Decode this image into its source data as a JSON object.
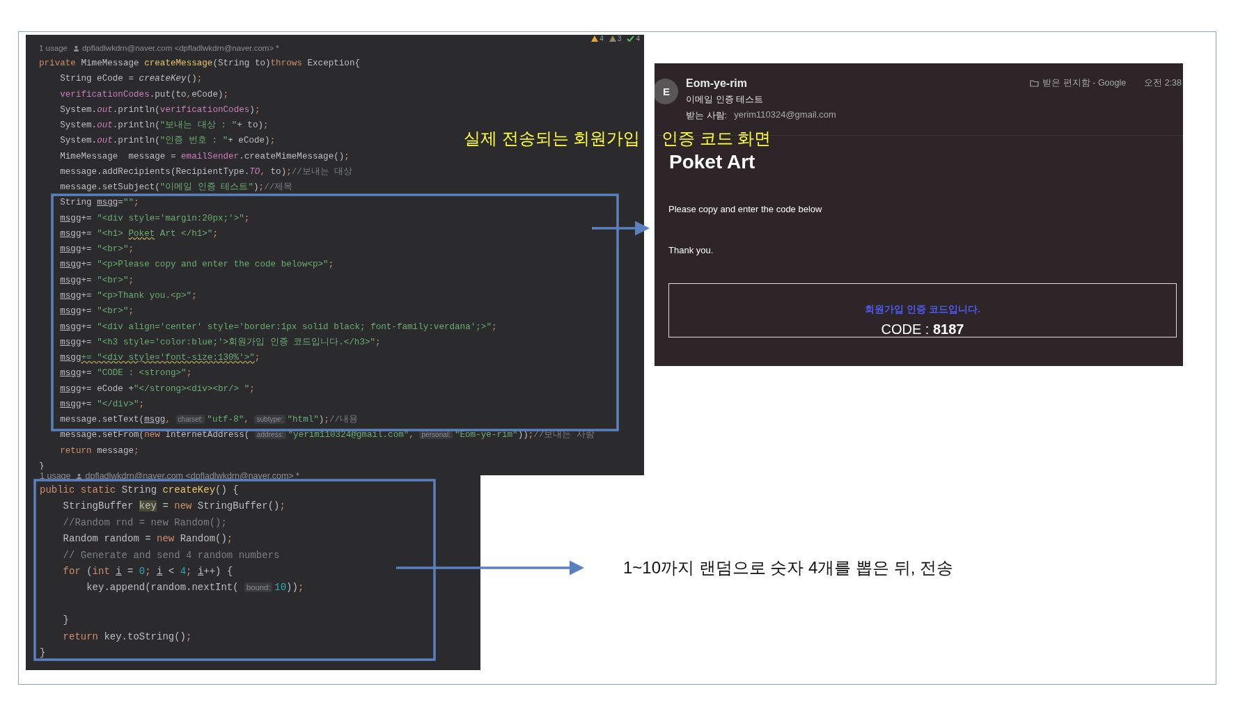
{
  "captions": [
    {
      "text": "실제 전송되는 회원가입"
    },
    {
      "text": "인증 코드 화면"
    }
  ],
  "code_panel_top": {
    "inspections": [
      {
        "kind": "warning",
        "count": "4"
      },
      {
        "kind": "weak_warning",
        "count": "3"
      },
      {
        "kind": "ok",
        "count": "4"
      }
    ],
    "usage": {
      "count": "1 usage",
      "author": "dpfladlwkdrn@naver.com <dpfladlwkdrn@naver.com> *"
    },
    "lines": [
      {
        "segments": [
          {
            "kind": "kw",
            "text": "private "
          },
          {
            "kind": "plain",
            "text": "MimeMessage "
          },
          {
            "kind": "fn",
            "text": "createMessage"
          },
          {
            "kind": "plain",
            "text": "(String to)"
          },
          {
            "kind": "kw",
            "text": "throws "
          },
          {
            "kind": "plain",
            "text": "Exception{"
          }
        ],
        "children": [
          {
            "segments": [
              {
                "kind": "plain",
                "text": "String eCode = "
              },
              {
                "kind": "italic",
                "text": "createKey"
              },
              {
                "kind": "plain",
                "text": "()"
              },
              {
                "kind": "punct",
                "text": ";"
              }
            ]
          },
          {
            "segments": [
              {
                "kind": "field",
                "text": "verificationCodes"
              },
              {
                "kind": "plain",
                "text": ".put(to"
              },
              {
                "kind": "punct",
                "text": ","
              },
              {
                "kind": "plain",
                "text": "eCode)"
              },
              {
                "kind": "punct",
                "text": ";"
              }
            ]
          },
          {
            "segments": [
              {
                "kind": "plain",
                "text": "System."
              },
              {
                "kind": "static",
                "text": "out"
              },
              {
                "kind": "plain",
                "text": ".println("
              },
              {
                "kind": "field",
                "text": "verificationCodes"
              },
              {
                "kind": "plain",
                "text": ")"
              },
              {
                "kind": "punct",
                "text": ";"
              }
            ]
          },
          {
            "segments": [
              {
                "kind": "plain",
                "text": "System."
              },
              {
                "kind": "static",
                "text": "out"
              },
              {
                "kind": "plain",
                "text": ".println("
              },
              {
                "kind": "str",
                "text": "\"보내는 대상 : \""
              },
              {
                "kind": "plain",
                "text": "+ to)"
              },
              {
                "kind": "punct",
                "text": ";"
              }
            ]
          },
          {
            "segments": [
              {
                "kind": "plain",
                "text": "System."
              },
              {
                "kind": "static",
                "text": "out"
              },
              {
                "kind": "plain",
                "text": ".println("
              },
              {
                "kind": "str",
                "text": "\"인증 번호 : \""
              },
              {
                "kind": "plain",
                "text": "+ eCode)"
              },
              {
                "kind": "punct",
                "text": ";"
              }
            ]
          },
          {
            "segments": [
              {
                "kind": "plain",
                "text": "MimeMessage  message = "
              },
              {
                "kind": "field",
                "text": "emailSender"
              },
              {
                "kind": "plain",
                "text": ".createMimeMessage()"
              },
              {
                "kind": "punct",
                "text": ";"
              }
            ]
          },
          {
            "segments": [
              {
                "kind": "plain",
                "text": "message.addRecipients(RecipientType."
              },
              {
                "kind": "static",
                "text": "TO"
              },
              {
                "kind": "punct",
                "text": ", "
              },
              {
                "kind": "plain",
                "text": "to)"
              },
              {
                "kind": "punct",
                "text": ";"
              },
              {
                "kind": "comment",
                "text": "//보내는 대상"
              }
            ]
          },
          {
            "segments": [
              {
                "kind": "plain",
                "text": "message.setSubject("
              },
              {
                "kind": "str",
                "text": "\"이메일 인증 테스트\""
              },
              {
                "kind": "plain",
                "text": ")"
              },
              {
                "kind": "punct",
                "text": ";"
              },
              {
                "kind": "comment",
                "text": "//제목"
              }
            ]
          },
          {
            "segments": [
              {
                "kind": "plain",
                "text": "String "
              },
              {
                "kind": "var",
                "text": "msgg"
              },
              {
                "kind": "plain",
                "text": "="
              },
              {
                "kind": "str",
                "text": "\"\""
              },
              {
                "kind": "punct",
                "text": ";"
              }
            ]
          },
          {
            "segments": [
              {
                "kind": "var",
                "text": "msgg"
              },
              {
                "kind": "plain",
                "text": "+= "
              },
              {
                "kind": "str",
                "text": "\"<div style='margin:20px;'>\""
              },
              {
                "kind": "punct",
                "text": ";"
              }
            ]
          },
          {
            "segments": [
              {
                "kind": "var",
                "text": "msgg"
              },
              {
                "kind": "plain",
                "text": "+= "
              },
              {
                "kind": "str",
                "text": "\"<h1> "
              },
              {
                "kind": "strwarn",
                "text": "Poket"
              },
              {
                "kind": "str",
                "text": " Art </h1>\""
              },
              {
                "kind": "punct",
                "text": ";"
              }
            ]
          },
          {
            "segments": [
              {
                "kind": "var",
                "text": "msgg"
              },
              {
                "kind": "plain",
                "text": "+= "
              },
              {
                "kind": "str",
                "text": "\"<br>\""
              },
              {
                "kind": "punct",
                "text": ";"
              }
            ]
          },
          {
            "segments": [
              {
                "kind": "var",
                "text": "msgg"
              },
              {
                "kind": "plain",
                "text": "+= "
              },
              {
                "kind": "str",
                "text": "\"<p>Please copy and enter the code below<p>\""
              },
              {
                "kind": "punct",
                "text": ";"
              }
            ]
          },
          {
            "segments": [
              {
                "kind": "var",
                "text": "msgg"
              },
              {
                "kind": "plain",
                "text": "+= "
              },
              {
                "kind": "str",
                "text": "\"<br>\""
              },
              {
                "kind": "punct",
                "text": ";"
              }
            ]
          },
          {
            "segments": [
              {
                "kind": "var",
                "text": "msgg"
              },
              {
                "kind": "plain",
                "text": "+= "
              },
              {
                "kind": "str",
                "text": "\"<p>Thank you.<p>\""
              },
              {
                "kind": "punct",
                "text": ";"
              }
            ]
          },
          {
            "segments": [
              {
                "kind": "var",
                "text": "msgg"
              },
              {
                "kind": "plain",
                "text": "+= "
              },
              {
                "kind": "str",
                "text": "\"<br>\""
              },
              {
                "kind": "punct",
                "text": ";"
              }
            ]
          },
          {
            "segments": [
              {
                "kind": "var",
                "text": "msgg"
              },
              {
                "kind": "plain",
                "text": "+= "
              },
              {
                "kind": "str",
                "text": "\"<div align='center' style='border:1px solid black; font-family:verdana';>\""
              },
              {
                "kind": "punct",
                "text": ";"
              }
            ]
          },
          {
            "segments": [
              {
                "kind": "var",
                "text": "msgg"
              },
              {
                "kind": "plain",
                "text": "+= "
              },
              {
                "kind": "str",
                "text": "\"<h3 style='color:blue;'>회원가입 인증 코드입니다.</h3>\""
              },
              {
                "kind": "punct",
                "text": ";"
              }
            ]
          },
          {
            "segments": [
              {
                "kind": "var",
                "text": "msgg"
              },
              {
                "kind": "strwarn",
                "text": "+= \"<div style='font-size:130%'>\""
              },
              {
                "kind": "punct",
                "text": ";"
              }
            ]
          },
          {
            "segments": [
              {
                "kind": "var",
                "text": "msgg"
              },
              {
                "kind": "plain",
                "text": "+= "
              },
              {
                "kind": "str",
                "text": "\"CODE : <strong>\""
              },
              {
                "kind": "punct",
                "text": ";"
              }
            ]
          },
          {
            "segments": [
              {
                "kind": "var",
                "text": "msgg"
              },
              {
                "kind": "plain",
                "text": "+= eCode +"
              },
              {
                "kind": "str",
                "text": "\"</strong><div><br/> \""
              },
              {
                "kind": "punct",
                "text": ";"
              }
            ]
          },
          {
            "segments": [
              {
                "kind": "var",
                "text": "msgg"
              },
              {
                "kind": "plain",
                "text": "+= "
              },
              {
                "kind": "str",
                "text": "\"</div>\""
              },
              {
                "kind": "punct",
                "text": ";"
              }
            ]
          },
          {
            "segments": [
              {
                "kind": "plain",
                "text": "message.setText("
              },
              {
                "kind": "var",
                "text": "msgg"
              },
              {
                "kind": "punct",
                "text": ", "
              },
              {
                "kind": "hint",
                "text": "charset:"
              },
              {
                "kind": "str",
                "text": "\"utf-8\""
              },
              {
                "kind": "punct",
                "text": ", "
              },
              {
                "kind": "hint",
                "text": "subtype:"
              },
              {
                "kind": "str",
                "text": "\"html\""
              },
              {
                "kind": "plain",
                "text": ")"
              },
              {
                "kind": "punct",
                "text": ";"
              },
              {
                "kind": "comment",
                "text": "//내용"
              }
            ]
          },
          {
            "segments": [
              {
                "kind": "plain",
                "text": "message.setFrom("
              },
              {
                "kind": "kw",
                "text": "new "
              },
              {
                "kind": "plain",
                "text": "InternetAddress( "
              },
              {
                "kind": "hint",
                "text": "address:"
              },
              {
                "kind": "str",
                "text": "\"yerim110324@gmail.com\""
              },
              {
                "kind": "punct",
                "text": ", "
              },
              {
                "kind": "hint",
                "text": "personal:"
              },
              {
                "kind": "str",
                "text": "\"Eom-ye-rim\""
              },
              {
                "kind": "plain",
                "text": "))"
              },
              {
                "kind": "punct",
                "text": ";"
              },
              {
                "kind": "comment",
                "text": "//보내는 사람"
              }
            ]
          },
          {
            "segments": [
              {
                "kind": "kw",
                "text": "return "
              },
              {
                "kind": "plain",
                "text": "message"
              },
              {
                "kind": "punct",
                "text": ";"
              }
            ]
          }
        ]
      },
      {
        "segments": [
          {
            "kind": "plain",
            "text": "}"
          }
        ]
      }
    ]
  },
  "code_panel_bottom": {
    "usage": {
      "count": "1 usage",
      "author": "dpfladlwkdrn@naver.com <dpfladlwkdrn@naver.com> *"
    },
    "lines": [
      {
        "segments": [
          {
            "kind": "kw",
            "text": "public static "
          },
          {
            "kind": "plain",
            "text": "String "
          },
          {
            "kind": "fn",
            "text": "createKey"
          },
          {
            "kind": "plain",
            "text": "() {"
          }
        ],
        "children": [
          {
            "segments": [
              {
                "kind": "plain",
                "text": "StringBuffer "
              },
              {
                "kind": "hl",
                "text": "key"
              },
              {
                "kind": "plain",
                "text": " = "
              },
              {
                "kind": "kw",
                "text": "new "
              },
              {
                "kind": "plain",
                "text": "StringBuffer()"
              },
              {
                "kind": "punct",
                "text": ";"
              }
            ]
          },
          {
            "segments": [
              {
                "kind": "comment",
                "text": "//Random rnd = new Random();"
              }
            ]
          },
          {
            "segments": [
              {
                "kind": "plain",
                "text": "Random random = "
              },
              {
                "kind": "kw",
                "text": "new "
              },
              {
                "kind": "plain",
                "text": "Random()"
              },
              {
                "kind": "punct",
                "text": ";"
              }
            ]
          },
          {
            "segments": [
              {
                "kind": "comment",
                "text": "// Generate and send 4 random numbers"
              }
            ]
          },
          {
            "segments": [
              {
                "kind": "kw",
                "text": "for "
              },
              {
                "kind": "plain",
                "text": "("
              },
              {
                "kind": "kw",
                "text": "int "
              },
              {
                "kind": "var",
                "text": "i"
              },
              {
                "kind": "plain",
                "text": " = "
              },
              {
                "kind": "num",
                "text": "0"
              },
              {
                "kind": "punct",
                "text": "; "
              },
              {
                "kind": "var",
                "text": "i"
              },
              {
                "kind": "plain",
                "text": " < "
              },
              {
                "kind": "num",
                "text": "4"
              },
              {
                "kind": "punct",
                "text": "; "
              },
              {
                "kind": "var",
                "text": "i"
              },
              {
                "kind": "plain",
                "text": "++) {"
              }
            ],
            "children": [
              {
                "segments": [
                  {
                    "kind": "plain",
                    "text": "key.append(random.nextInt( "
                  },
                  {
                    "kind": "hint",
                    "text": "bound:"
                  },
                  {
                    "kind": "num",
                    "text": "10"
                  },
                  {
                    "kind": "plain",
                    "text": "))"
                  },
                  {
                    "kind": "punct",
                    "text": ";"
                  }
                ]
              }
            ]
          },
          {
            "segments": [
              {
                "kind": "plain",
                "text": "}"
              }
            ],
            "gap_before": true
          },
          {
            "segments": [
              {
                "kind": "kw",
                "text": "return "
              },
              {
                "kind": "plain",
                "text": "key.toString()"
              },
              {
                "kind": "punct",
                "text": ";"
              }
            ]
          }
        ]
      },
      {
        "segments": [
          {
            "kind": "plain",
            "text": "}"
          }
        ]
      }
    ]
  },
  "email": {
    "avatar": "E",
    "sender": "Eom-ye-rim",
    "subject": "이메일 인증 테스트",
    "to_label": "받는 사람:",
    "to_address": "yerim110324@gmail.com",
    "folder": "받은 편지함 - Google",
    "time": "오전 2:38",
    "body": {
      "heading": "Poket Art",
      "paragraphs": [
        "Please copy and enter the code below",
        "Thank you."
      ],
      "code_box": {
        "title": "회원가입 인증 코드입니다.",
        "code": "CODE : **8187**"
      }
    }
  },
  "note": "1~10까지 랜덤으로 숫자 4개를 뽑은 뒤, 전송"
}
